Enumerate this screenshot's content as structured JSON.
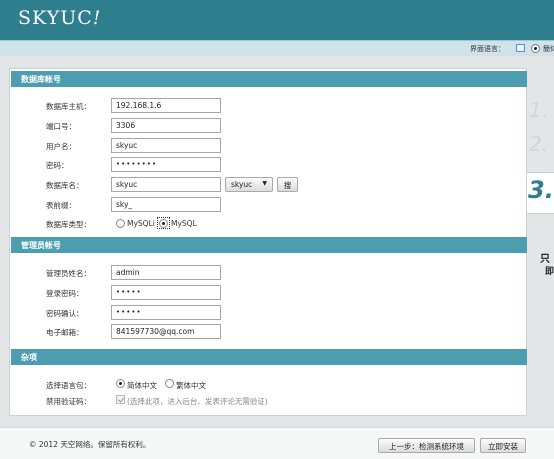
{
  "header": {
    "logo_text": "SKYUC",
    "logo_mark": "!"
  },
  "langbar": {
    "label": "界面语言：",
    "selected_text": "簡体"
  },
  "sections": {
    "database": "数据库帐号",
    "admin": "管理员帐号",
    "misc": "杂项"
  },
  "database": {
    "host_label": "数据库主机：",
    "host_value": "192.168.1.6",
    "port_label": "端口号：",
    "port_value": "3306",
    "user_label": "用户名：",
    "user_value": "skyuc",
    "password_label": "密码：",
    "password_value": "••••••••",
    "name_label": "数据库名：",
    "name_value": "skyuc",
    "name_select": "skyuc",
    "search_button": "搜",
    "prefix_label": "表前缀：",
    "prefix_value": "sky_",
    "type_label": "数据库类型：",
    "type_options": [
      "MySQLi",
      "MySQL"
    ],
    "type_selected": "MySQL"
  },
  "admin": {
    "name_label": "管理员姓名：",
    "name_value": "admin",
    "password_label": "登录密码：",
    "password_value": "•••••",
    "confirm_label": "密码确认：",
    "confirm_value": "•••••",
    "email_label": "电子邮箱：",
    "email_value": "841597730@qq.com"
  },
  "misc": {
    "language_label": "选择语言包：",
    "language_options": [
      "简体中文",
      "繁体中文"
    ],
    "language_selected": "简体中文",
    "captcha_label": "禁用验证码：",
    "captcha_hint": "(选择此项，进入后台、发表评论无需验证)"
  },
  "steps": {
    "step1": "1.",
    "step2": "2.",
    "step3": "3.",
    "note1": "只",
    "note2": "即"
  },
  "footer": {
    "copyright": "© 2012 天空网络。保留所有权利。",
    "prev_button": "上一步：检测系统环境",
    "install_button": "立即安装"
  },
  "colors": {
    "header": "#2e7e8e",
    "section_head": "#4d9db1",
    "langbar": "#cfe3e8"
  }
}
